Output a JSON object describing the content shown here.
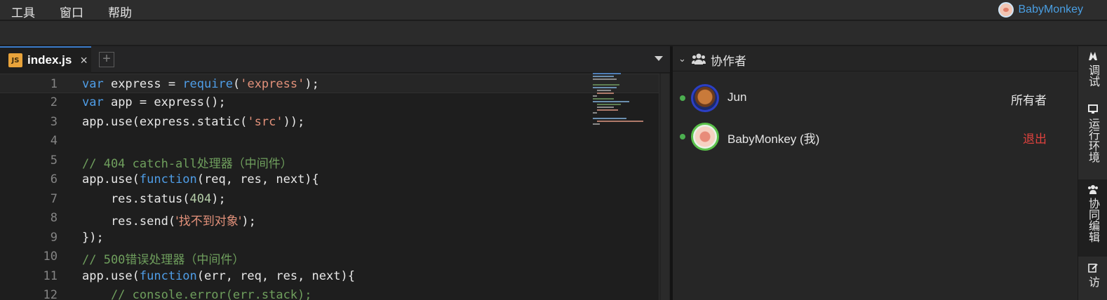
{
  "menubar": {
    "items": [
      "工具",
      "窗口",
      "帮助"
    ],
    "user_name": "BabyMonkey"
  },
  "editor": {
    "tab": {
      "label": "index.js",
      "icon_text": "JS",
      "close": "×"
    },
    "add_tab": "+",
    "lines": [
      {
        "n": "1"
      },
      {
        "n": "2"
      },
      {
        "n": "3"
      },
      {
        "n": "4"
      },
      {
        "n": "5"
      },
      {
        "n": "6"
      },
      {
        "n": "7"
      },
      {
        "n": "8"
      },
      {
        "n": "9"
      },
      {
        "n": "10"
      },
      {
        "n": "11"
      },
      {
        "n": "12"
      }
    ],
    "code": {
      "l1": {
        "kw": "var",
        "a": " express = ",
        "kw2": "require",
        "b": "(",
        "str": "'express'",
        "c": ");"
      },
      "l2": {
        "kw": "var",
        "a": " app = express();"
      },
      "l3": {
        "a": "app.use(express.static(",
        "str": "'src'",
        "b": "));"
      },
      "l5": {
        "cm": "// 404 catch-all",
        "cm_cjk": "处理器（中间件）"
      },
      "l6": {
        "a": "app.use(",
        "kw": "function",
        "b": "(req, res, next){"
      },
      "l7": {
        "a": "    res.status(",
        "num": "404",
        "b": ");"
      },
      "l8": {
        "a": "    res.send(",
        "str": "'找不到对象'",
        "b": ");"
      },
      "l9": {
        "a": "});"
      },
      "l10": {
        "cm": "// 500",
        "cm_cjk": "错误处理器（中间件）"
      },
      "l11": {
        "a": "app.use(",
        "kw": "function",
        "b": "(err, req, res, next){"
      },
      "l12": {
        "cm": "    // console.error(err.stack);"
      }
    }
  },
  "collaborators": {
    "title": "协作者",
    "members": [
      {
        "name": "Jun",
        "role": "所有者",
        "online": true
      },
      {
        "name": "BabyMonkey (我)",
        "role": "退出",
        "online": true
      }
    ]
  },
  "sidebar": {
    "tabs": [
      {
        "label": "调试",
        "icon": "debug-icon"
      },
      {
        "label": "运行环境",
        "icon": "terminal-icon"
      },
      {
        "label": "协同编辑",
        "icon": "people-icon"
      },
      {
        "label": "访",
        "icon": "edit-icon"
      }
    ]
  },
  "colors": {
    "accent": "#4a9fe3",
    "keyword": "#4f9ee8",
    "string": "#e2917a",
    "comment": "#6f9f5d",
    "exit": "#e0423e",
    "online": "#4caf50"
  }
}
